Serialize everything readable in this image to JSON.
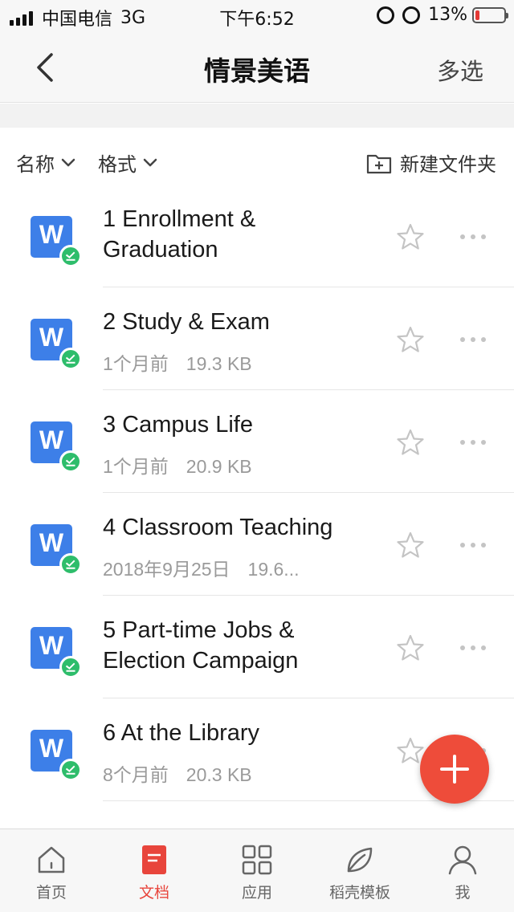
{
  "status_bar": {
    "carrier": "中国电信",
    "network": "3G",
    "time": "下午6:52",
    "battery": "13%",
    "battery_level": 0.13
  },
  "nav": {
    "title": "情景美语",
    "multi_select": "多选"
  },
  "toolbar": {
    "sort_name": "名称",
    "sort_format": "格式",
    "new_folder": "新建文件夹"
  },
  "files": [
    {
      "title_line1": "1 Enrollment &",
      "title_line2": "Graduation",
      "date": "",
      "size": ""
    },
    {
      "title_line1": "2 Study & Exam",
      "title_line2": "",
      "date": "1个月前",
      "size": "19.3 KB"
    },
    {
      "title_line1": "3 Campus Life",
      "title_line2": "",
      "date": "1个月前",
      "size": "20.9 KB"
    },
    {
      "title_line1": "4 Classroom Teaching",
      "title_line2": "",
      "date": "2018年9月25日",
      "size": "19.6..."
    },
    {
      "title_line1": "5 Part-time Jobs &",
      "title_line2": "Election Campaign",
      "date": "",
      "size": ""
    },
    {
      "title_line1": "6 At the Library",
      "title_line2": "",
      "date": "8个月前",
      "size": "20.3 KB"
    }
  ],
  "doc_icon_letter": "W",
  "tabs": [
    {
      "label": "首页",
      "icon": "home-icon"
    },
    {
      "label": "文档",
      "icon": "document-icon"
    },
    {
      "label": "应用",
      "icon": "apps-icon"
    },
    {
      "label": "稻壳模板",
      "icon": "leaf-icon"
    },
    {
      "label": "我",
      "icon": "profile-icon"
    }
  ],
  "colors": {
    "accent": "#e8453c",
    "doc_blue": "#3d7fe8",
    "sync_green": "#2ebd6b"
  }
}
